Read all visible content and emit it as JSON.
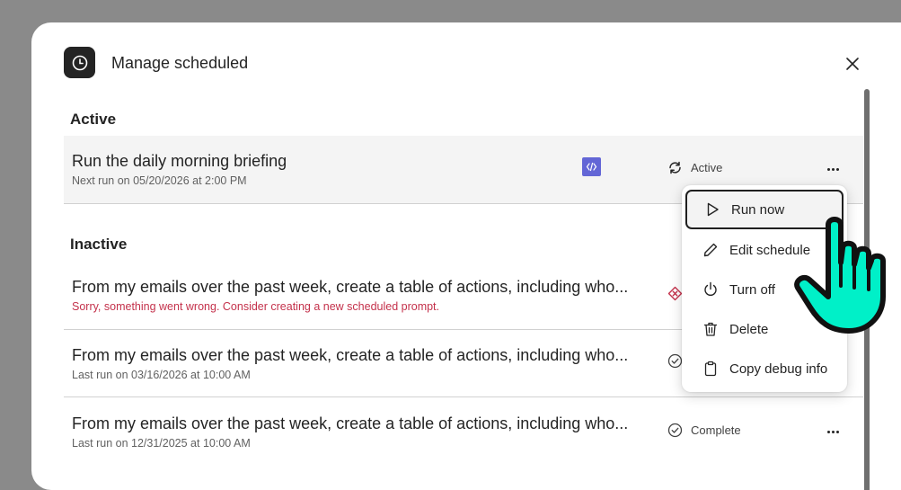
{
  "dialog": {
    "title": "Manage scheduled"
  },
  "sections": {
    "active": "Active",
    "inactive": "Inactive"
  },
  "rows": [
    {
      "title": "Run the daily morning briefing",
      "subtitle": "Next run on 05/20/2026 at 2:00 PM",
      "status": "Active"
    },
    {
      "title": "From my emails over the past week, create a table of actions, including who...",
      "subtitle": "Sorry, something went wrong. Consider creating a new scheduled prompt.",
      "status": ""
    },
    {
      "title": "From my emails over the past week, create a table of actions, including who...",
      "subtitle": "Last run on 03/16/2026 at 10:00 AM",
      "status": ""
    },
    {
      "title": "From my emails over the past week, create a table of actions, including who...",
      "subtitle": "Last run on 12/31/2025 at 10:00 AM",
      "status": "Complete"
    }
  ],
  "menu": {
    "items": [
      {
        "label": "Run now",
        "icon": "play-icon"
      },
      {
        "label": "Edit schedule",
        "icon": "pencil-icon"
      },
      {
        "label": "Turn off",
        "icon": "power-icon"
      },
      {
        "label": "Delete",
        "icon": "trash-icon"
      },
      {
        "label": "Copy debug info",
        "icon": "clipboard-icon"
      }
    ]
  },
  "colors": {
    "error": "#c4314b",
    "plugin_badge": "#6366d6",
    "cursor_fill": "#00f0c8"
  }
}
